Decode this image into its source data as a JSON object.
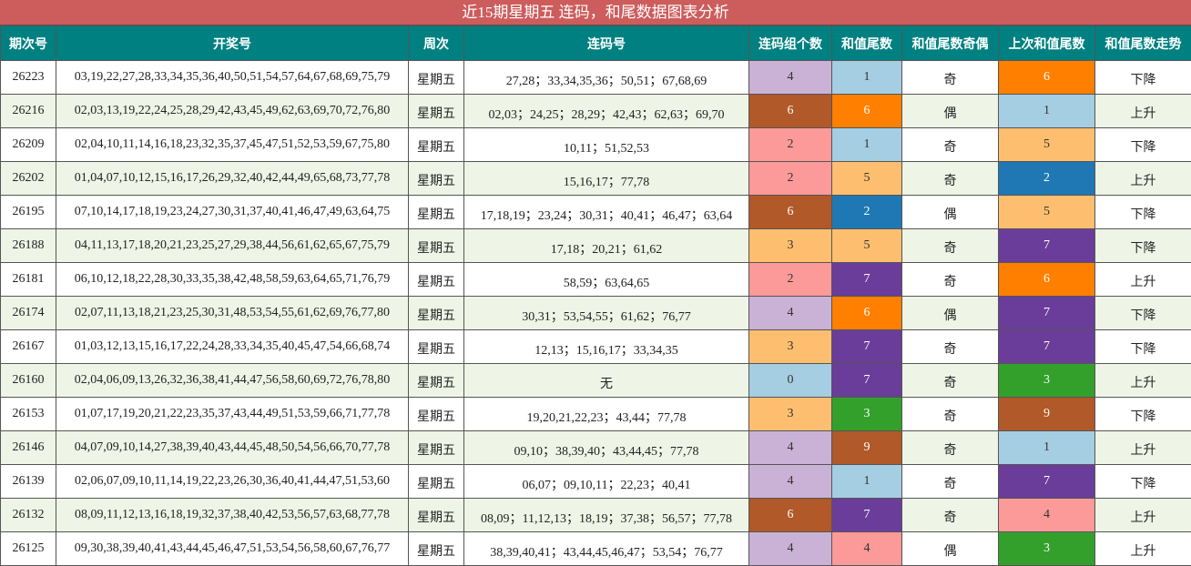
{
  "title": "近15期星期五 连码，和尾数据图表分析",
  "headers": [
    "期次号",
    "开奖号",
    "周次",
    "连码号",
    "连码组个数",
    "和值尾数",
    "和值尾数奇偶",
    "上次和值尾数",
    "和值尾数走势"
  ],
  "colors": {
    "title_bg": "#cd5c5c",
    "header_bg": "#008080",
    "alt_row_bg": "#eef5e6",
    "palette": {
      "0": "#a6cee3",
      "1": "#a6cee3",
      "2": "#fb9a99",
      "3": "#fdbf6f",
      "4": "#cab2d6",
      "5": "#fdbf6f",
      "6": "#b15928",
      "7": "#6a3d9a",
      "9": "#b15928"
    }
  },
  "rows": [
    {
      "issue": "26223",
      "numbers": "03,19,22,27,28,33,34,35,36,40,50,51,54,57,64,67,68,69,75,79",
      "weekday": "星期五",
      "lianma": "27,28；33,34,35,36；50,51；67,68,69",
      "groups": "4",
      "groups_color": "#cab2d6",
      "groups_text": "#333333",
      "tail": "1",
      "tail_color": "#a6cee3",
      "tail_text": "#333333",
      "parity": "奇",
      "prev_tail": "6",
      "prev_color": "#ff7f00",
      "prev_text": "#ffffff",
      "trend": "下降"
    },
    {
      "issue": "26216",
      "numbers": "02,03,13,19,22,24,25,28,29,42,43,45,49,62,63,69,70,72,76,80",
      "weekday": "星期五",
      "lianma": "02,03；24,25；28,29；42,43；62,63；69,70",
      "groups": "6",
      "groups_color": "#b15928",
      "groups_text": "#ffffff",
      "tail": "6",
      "tail_color": "#ff7f00",
      "tail_text": "#ffffff",
      "parity": "偶",
      "prev_tail": "1",
      "prev_color": "#a6cee3",
      "prev_text": "#333333",
      "trend": "上升"
    },
    {
      "issue": "26209",
      "numbers": "02,04,10,11,14,16,18,23,32,35,37,45,47,51,52,53,59,67,75,80",
      "weekday": "星期五",
      "lianma": "10,11；51,52,53",
      "groups": "2",
      "groups_color": "#fb9a99",
      "groups_text": "#333333",
      "tail": "1",
      "tail_color": "#a6cee3",
      "tail_text": "#333333",
      "parity": "奇",
      "prev_tail": "5",
      "prev_color": "#fdbf6f",
      "prev_text": "#333333",
      "trend": "下降"
    },
    {
      "issue": "26202",
      "numbers": "01,04,07,10,12,15,16,17,26,29,32,40,42,44,49,65,68,73,77,78",
      "weekday": "星期五",
      "lianma": "15,16,17；77,78",
      "groups": "2",
      "groups_color": "#fb9a99",
      "groups_text": "#333333",
      "tail": "5",
      "tail_color": "#fdbf6f",
      "tail_text": "#333333",
      "parity": "奇",
      "prev_tail": "2",
      "prev_color": "#1f78b4",
      "prev_text": "#ffffff",
      "trend": "上升"
    },
    {
      "issue": "26195",
      "numbers": "07,10,14,17,18,19,23,24,27,30,31,37,40,41,46,47,49,63,64,75",
      "weekday": "星期五",
      "lianma": "17,18,19；23,24；30,31；40,41；46,47；63,64",
      "groups": "6",
      "groups_color": "#b15928",
      "groups_text": "#ffffff",
      "tail": "2",
      "tail_color": "#1f78b4",
      "tail_text": "#ffffff",
      "parity": "偶",
      "prev_tail": "5",
      "prev_color": "#fdbf6f",
      "prev_text": "#333333",
      "trend": "下降"
    },
    {
      "issue": "26188",
      "numbers": "04,11,13,17,18,20,21,23,25,27,29,38,44,56,61,62,65,67,75,79",
      "weekday": "星期五",
      "lianma": "17,18；20,21；61,62",
      "groups": "3",
      "groups_color": "#fdbf6f",
      "groups_text": "#333333",
      "tail": "5",
      "tail_color": "#fdbf6f",
      "tail_text": "#333333",
      "parity": "奇",
      "prev_tail": "7",
      "prev_color": "#6a3d9a",
      "prev_text": "#ffffff",
      "trend": "下降"
    },
    {
      "issue": "26181",
      "numbers": "06,10,12,18,22,28,30,33,35,38,42,48,58,59,63,64,65,71,76,79",
      "weekday": "星期五",
      "lianma": "58,59；63,64,65",
      "groups": "2",
      "groups_color": "#fb9a99",
      "groups_text": "#333333",
      "tail": "7",
      "tail_color": "#6a3d9a",
      "tail_text": "#ffffff",
      "parity": "奇",
      "prev_tail": "6",
      "prev_color": "#ff7f00",
      "prev_text": "#ffffff",
      "trend": "上升"
    },
    {
      "issue": "26174",
      "numbers": "02,07,11,13,18,21,23,25,30,31,48,53,54,55,61,62,69,76,77,80",
      "weekday": "星期五",
      "lianma": "30,31；53,54,55；61,62；76,77",
      "groups": "4",
      "groups_color": "#cab2d6",
      "groups_text": "#333333",
      "tail": "6",
      "tail_color": "#ff7f00",
      "tail_text": "#ffffff",
      "parity": "偶",
      "prev_tail": "7",
      "prev_color": "#6a3d9a",
      "prev_text": "#ffffff",
      "trend": "下降"
    },
    {
      "issue": "26167",
      "numbers": "01,03,12,13,15,16,17,22,24,28,33,34,35,40,45,47,54,66,68,74",
      "weekday": "星期五",
      "lianma": "12,13；15,16,17；33,34,35",
      "groups": "3",
      "groups_color": "#fdbf6f",
      "groups_text": "#333333",
      "tail": "7",
      "tail_color": "#6a3d9a",
      "tail_text": "#ffffff",
      "parity": "奇",
      "prev_tail": "7",
      "prev_color": "#6a3d9a",
      "prev_text": "#ffffff",
      "trend": "下降"
    },
    {
      "issue": "26160",
      "numbers": "02,04,06,09,13,26,32,36,38,41,44,47,56,58,60,69,72,76,78,80",
      "weekday": "星期五",
      "lianma": "无",
      "groups": "0",
      "groups_color": "#a6cee3",
      "groups_text": "#333333",
      "tail": "7",
      "tail_color": "#6a3d9a",
      "tail_text": "#ffffff",
      "parity": "奇",
      "prev_tail": "3",
      "prev_color": "#33a02c",
      "prev_text": "#ffffff",
      "trend": "上升"
    },
    {
      "issue": "26153",
      "numbers": "01,07,17,19,20,21,22,23,35,37,43,44,49,51,53,59,66,71,77,78",
      "weekday": "星期五",
      "lianma": "19,20,21,22,23；43,44；77,78",
      "groups": "3",
      "groups_color": "#fdbf6f",
      "groups_text": "#333333",
      "tail": "3",
      "tail_color": "#33a02c",
      "tail_text": "#ffffff",
      "parity": "奇",
      "prev_tail": "9",
      "prev_color": "#b15928",
      "prev_text": "#ffffff",
      "trend": "下降"
    },
    {
      "issue": "26146",
      "numbers": "04,07,09,10,14,27,38,39,40,43,44,45,48,50,54,56,66,70,77,78",
      "weekday": "星期五",
      "lianma": "09,10；38,39,40；43,44,45；77,78",
      "groups": "4",
      "groups_color": "#cab2d6",
      "groups_text": "#333333",
      "tail": "9",
      "tail_color": "#b15928",
      "tail_text": "#ffffff",
      "parity": "奇",
      "prev_tail": "1",
      "prev_color": "#a6cee3",
      "prev_text": "#333333",
      "trend": "上升"
    },
    {
      "issue": "26139",
      "numbers": "02,06,07,09,10,11,14,19,22,23,26,30,36,40,41,44,47,51,53,60",
      "weekday": "星期五",
      "lianma": "06,07；09,10,11；22,23；40,41",
      "groups": "4",
      "groups_color": "#cab2d6",
      "groups_text": "#333333",
      "tail": "1",
      "tail_color": "#a6cee3",
      "tail_text": "#333333",
      "parity": "奇",
      "prev_tail": "7",
      "prev_color": "#6a3d9a",
      "prev_text": "#ffffff",
      "trend": "下降"
    },
    {
      "issue": "26132",
      "numbers": "08,09,11,12,13,16,18,19,32,37,38,40,42,53,56,57,63,68,77,78",
      "weekday": "星期五",
      "lianma": "08,09；11,12,13；18,19；37,38；56,57；77,78",
      "groups": "6",
      "groups_color": "#b15928",
      "groups_text": "#ffffff",
      "tail": "7",
      "tail_color": "#6a3d9a",
      "tail_text": "#ffffff",
      "parity": "奇",
      "prev_tail": "4",
      "prev_color": "#fb9a99",
      "prev_text": "#333333",
      "trend": "上升"
    },
    {
      "issue": "26125",
      "numbers": "09,30,38,39,40,41,43,44,45,46,47,51,53,54,56,58,60,67,76,77",
      "weekday": "星期五",
      "lianma": "38,39,40,41；43,44,45,46,47；53,54；76,77",
      "groups": "4",
      "groups_color": "#cab2d6",
      "groups_text": "#333333",
      "tail": "4",
      "tail_color": "#fb9a99",
      "tail_text": "#333333",
      "parity": "偶",
      "prev_tail": "3",
      "prev_color": "#33a02c",
      "prev_text": "#ffffff",
      "trend": "上升"
    }
  ]
}
